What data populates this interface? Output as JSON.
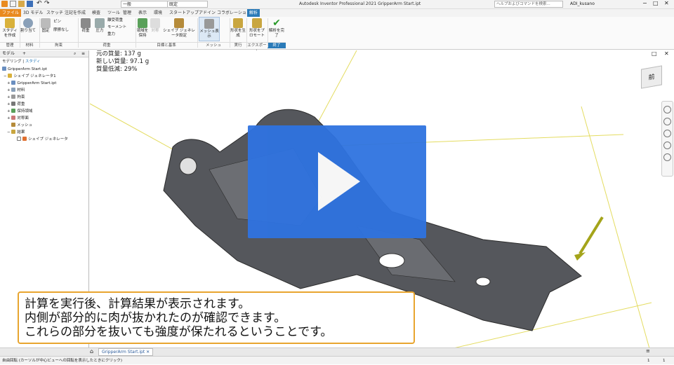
{
  "title": "Autodesk Inventor Professional 2021   GripperArm Start.ipt",
  "search_placeholder": "ヘルプおよびコマンドを検索...",
  "user": "ADI_kusano",
  "appearance": "一般",
  "material": "既定",
  "tabs": [
    "ファイル",
    "3D モデル",
    "スケッチ",
    "注記を作成",
    "検査",
    "ツール",
    "管理",
    "表示",
    "環境",
    "スタートアップ",
    "アドイン",
    "コラボレーション",
    "解析"
  ],
  "ribbon": {
    "study": "スタディを作成",
    "assign": "割り当て",
    "fixed": "固定",
    "pin": "ピン",
    "frictionless": "摩擦なし",
    "load": "荷重",
    "pressure": "圧力",
    "moment": "モーメント",
    "gravity": "重力",
    "body_load": "離受荷重",
    "preserve": "領域を保持",
    "symmetric": "対称",
    "generator_settings": "シェイプ ジェネレータ設定",
    "mesh_view": "メッシュ表示",
    "generate": "形状を生成",
    "promote": "形状をプロモート",
    "finish": "解析を完了"
  },
  "groups": [
    "管理",
    "材料",
    "拘束",
    "荷重",
    "目標と基準",
    "メッシュ",
    "実行",
    "エクスポート",
    "終了"
  ],
  "browser": {
    "title": "モデル",
    "tab_modeling": "モデリング",
    "tab_study": "スタディ",
    "items": [
      "GripperArm Start.ipt",
      "シェイプ ジェネレータ1",
      "GripperArm Start.ipt",
      "材料",
      "拘束",
      "荷重",
      "保持領域",
      "対称面",
      "メッシュ",
      "結果",
      "シェイプ ジェネレータ"
    ]
  },
  "stats": {
    "original": "元の質量: 137 g",
    "new": "新しい質量: 97.1 g",
    "reduction": "質量低減: 29%"
  },
  "subtitle": [
    "計算を実行後、計算結果が表示されます。",
    "内側が部分的に肉が抜かれたのが確認できます。",
    "これらの部分を抜いても強度が保たれるということです。"
  ],
  "doc_tab": "GripperArm Start.ipt",
  "status_text": "自由回転 (カーソルが中心ビューへの回転を表示したときにクリック)",
  "status_right": [
    "1",
    "1"
  ],
  "viewcube": "前"
}
